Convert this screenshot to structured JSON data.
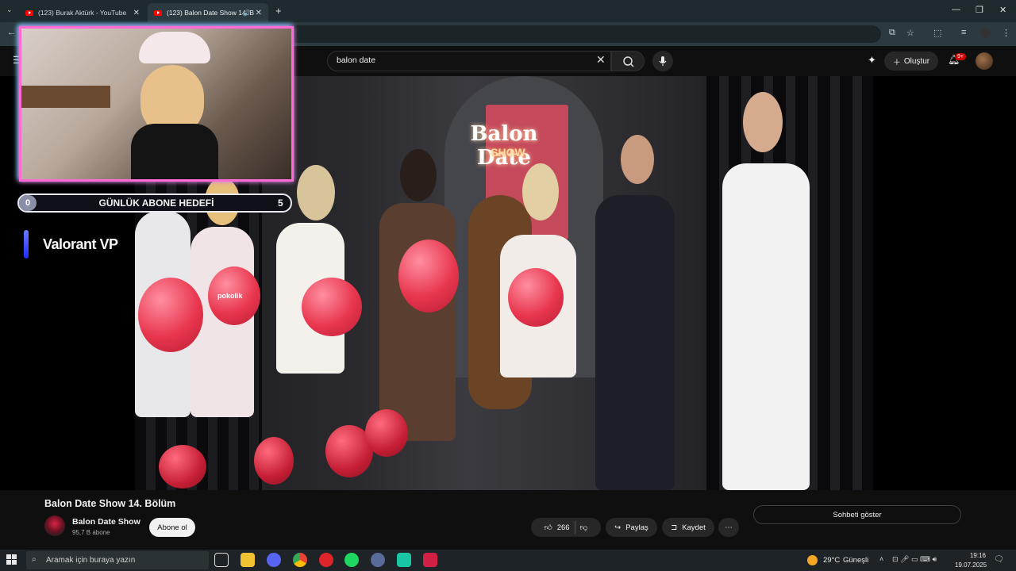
{
  "browser": {
    "tabs": [
      {
        "label": "(123) Burak Aktürk - YouTube"
      },
      {
        "label": "(123) Balon Date Show 14. B"
      }
    ],
    "new_tab": "+",
    "window_controls": {
      "minimize": "—",
      "restore": "❐",
      "close": "✕"
    }
  },
  "youtube": {
    "search": {
      "value": "balon date"
    },
    "create_label": "Oluştur",
    "notification_count": "9+"
  },
  "overlay": {
    "goal": {
      "current": "0",
      "label": "GÜNLÜK ABONE HEDEFİ",
      "target": "5"
    },
    "sponsor": "Valorant VP"
  },
  "video_frame": {
    "neon_title": "Balon Date",
    "neon_sub": "SHOW",
    "balloon_brand": "pokolik"
  },
  "video": {
    "title": "Balon Date Show 14. Bölüm",
    "channel": "Balon Date Show",
    "subscribers": "95,7 B abone",
    "subscribe_label": "Abone ol",
    "likes": "266",
    "share_label": "Paylaş",
    "save_label": "Kaydet",
    "show_chat_label": "Sohbeti göster"
  },
  "taskbar": {
    "search_placeholder": "Aramak için buraya yazın",
    "weather_temp": "29°C",
    "weather_desc": "Güneşli",
    "time": "19:16",
    "date": "19.07.2025"
  },
  "colors": {
    "yt_bg": "#0f0f0f",
    "overlay_border": "#ff6ad5",
    "balloon": "#e8364e",
    "youtube_red": "#ff0000"
  }
}
